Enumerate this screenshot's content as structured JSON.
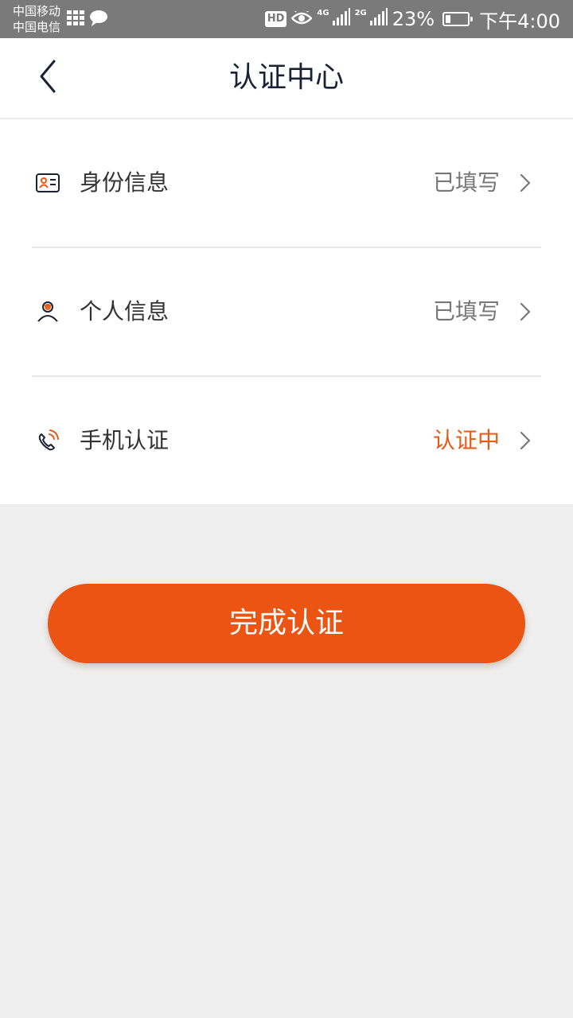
{
  "status_bar": {
    "carrier_1": "中国移动",
    "carrier_2": "中国电信",
    "hd_badge": "HD",
    "network_1": "4G",
    "network_2": "2G",
    "battery_percent_text": "23%",
    "battery_level": 0.23,
    "time": "下午4:00",
    "icons": [
      "app-grid-icon",
      "chat-bubble-icon",
      "eye-icon",
      "signal-icon",
      "signal-icon",
      "battery-icon"
    ]
  },
  "header": {
    "title": "认证中心",
    "back_icon": "chevron-left-icon"
  },
  "items": [
    {
      "label": "身份信息",
      "status": "已填写",
      "icon": "id-card-icon",
      "status_color": "#777777"
    },
    {
      "label": "个人信息",
      "status": "已填写",
      "icon": "person-icon",
      "status_color": "#777777"
    },
    {
      "label": "手机认证",
      "status": "认证中",
      "icon": "phone-icon",
      "status_color": "#e55a14"
    }
  ],
  "complete_button": {
    "label": "完成认证",
    "color": "#eb5412"
  },
  "colors": {
    "accent": "#eb5412",
    "status_bar": "#7a7a7a",
    "page_background": "#efefef"
  }
}
